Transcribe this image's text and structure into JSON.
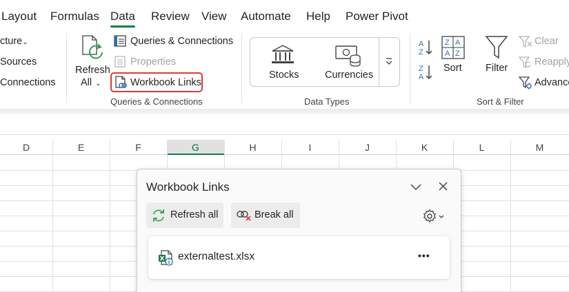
{
  "menu": {
    "tabs": [
      "Layout",
      "Formulas",
      "Data",
      "Review",
      "View",
      "Automate",
      "Help",
      "Power Pivot"
    ],
    "active_tab": "Data"
  },
  "ribbon": {
    "get_data": {
      "items": [
        "cture",
        "Sources",
        "Connections"
      ]
    },
    "queries_connections": {
      "refresh_all_line1": "Refresh",
      "refresh_all_line2": "All",
      "queries_label": "Queries & Connections",
      "properties_label": "Properties",
      "workbook_links_label": "Workbook Links",
      "group_label": "Queries & Connections"
    },
    "data_types": {
      "stocks_label": "Stocks",
      "currencies_label": "Currencies",
      "group_label": "Data Types"
    },
    "sort_filter": {
      "sort_label": "Sort",
      "filter_label": "Filter",
      "clear_label": "Clear",
      "reapply_label": "Reapply",
      "advanced_label": "Advance",
      "group_label": "Sort & Filter"
    }
  },
  "sheet": {
    "columns": [
      "D",
      "E",
      "F",
      "G",
      "H",
      "I",
      "J",
      "K",
      "L",
      "M"
    ],
    "selected_column": "G"
  },
  "workbook_links_pane": {
    "title": "Workbook Links",
    "refresh_all_label": "Refresh all",
    "break_all_label": "Break all",
    "file_name": "externaltest.xlsx",
    "more_options_label": "•••"
  },
  "colors": {
    "accent_green": "#107c41",
    "highlight_red": "#d93a3a",
    "text": "#242424"
  }
}
